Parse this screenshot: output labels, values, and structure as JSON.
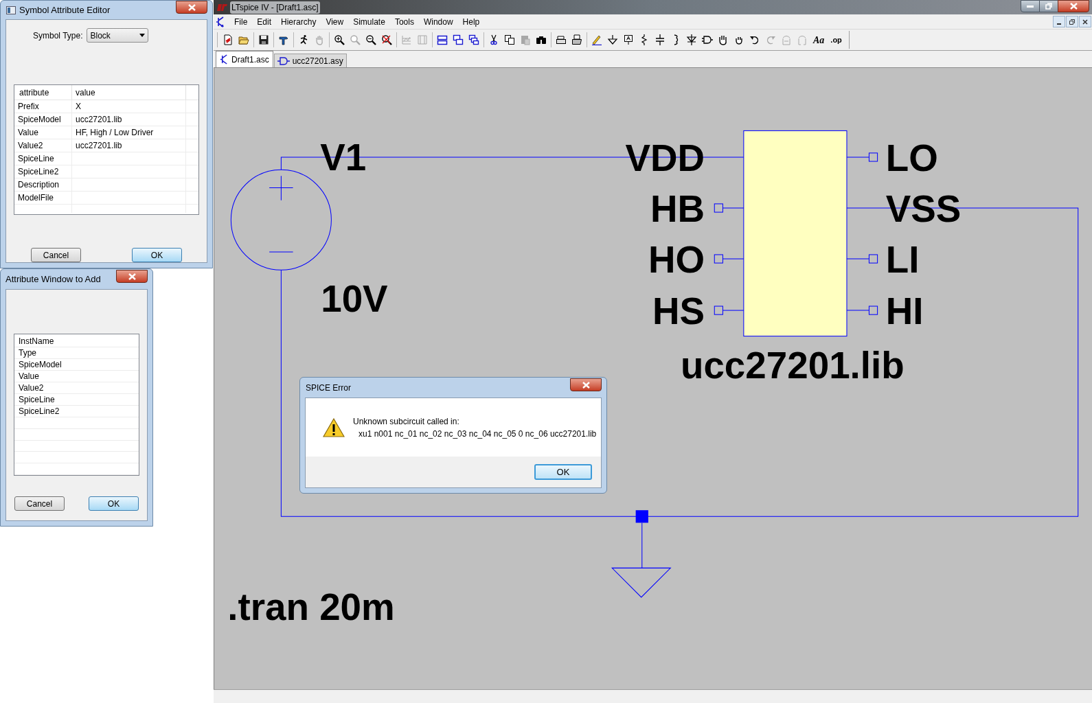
{
  "symbol_attribute_editor": {
    "title": "Symbol Attribute Editor",
    "symbol_type_label": "Symbol Type:",
    "symbol_type": "Block",
    "columns": [
      "attribute",
      "value"
    ],
    "rows": [
      {
        "attribute": "Prefix",
        "value": "X",
        "selected": false
      },
      {
        "attribute": "SpiceModel",
        "value": "ucc27201.lib",
        "selected": false
      },
      {
        "attribute": "Value",
        "value": "HF, High / Low Driver",
        "selected": false
      },
      {
        "attribute": "Value2",
        "value": "ucc27201.lib",
        "selected": false
      },
      {
        "attribute": "SpiceLine",
        "selected": false
      },
      {
        "attribute": "SpiceLine2",
        "selected": false
      },
      {
        "attribute": "Description",
        "selected": false
      },
      {
        "attribute": "ModelFile",
        "selected": false
      }
    ],
    "buttons": [
      "Cancel",
      "OK"
    ]
  },
  "attribute_window_to_add": {
    "title": "Attribute Window to Add",
    "items": [
      "InstName",
      "Type",
      "SpiceModel",
      "Value",
      "Value2",
      "SpiceLine",
      "SpiceLine2"
    ],
    "buttons": [
      "Cancel",
      "OK"
    ]
  },
  "main_window": {
    "title": "LTspice IV - [Draft1.asc]",
    "menu": [
      "File",
      "Edit",
      "Hierarchy",
      "View",
      "Simulate",
      "Tools",
      "Window",
      "Help"
    ],
    "toolbar_text_buttons": [
      "Aa",
      ".op"
    ],
    "tabs": [
      {
        "label": "Draft1.asc",
        "selected": true
      },
      {
        "label": "ucc27201.asy",
        "selected": false
      }
    ]
  },
  "schematic": {
    "source_name": "V1",
    "source_value": "10V",
    "pins_left": [
      "VDD",
      "HB",
      "HO",
      "HS"
    ],
    "pins_right": [
      "LO",
      "VSS",
      "LI",
      "HI"
    ],
    "block_name": "ucc27201.lib",
    "directive": ".tran 20m"
  },
  "spice_error": {
    "title": "SPICE Error",
    "message_lines": [
      "Unknown subcircuit called in:",
      "xu1 n001 nc_01 nc_02 nc_03 nc_04 nc_05 0 nc_06 ucc27201.lib"
    ],
    "button": "OK"
  }
}
